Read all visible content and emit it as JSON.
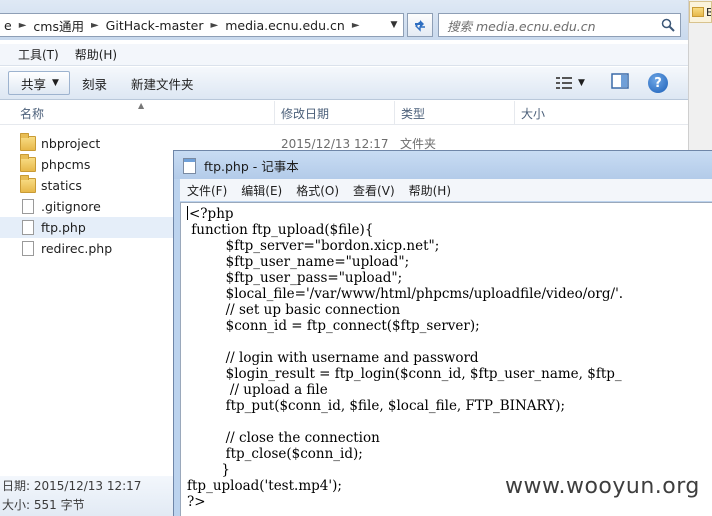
{
  "explorer": {
    "breadcrumbs": [
      "e",
      "cms通用",
      "GitHack-master",
      "media.ecnu.edu.cn"
    ],
    "search_placeholder": "搜索 media.ecnu.edu.cn",
    "menu": [
      "工具(T)",
      "帮助(H)"
    ],
    "toolbar": {
      "share": "共享",
      "burn": "刻录",
      "new_folder": "新建文件夹"
    },
    "columns": {
      "name": "名称",
      "modified": "修改日期",
      "type": "类型",
      "size": "大小"
    },
    "files": [
      {
        "name": "nbproject",
        "kind": "folder"
      },
      {
        "name": "phpcms",
        "kind": "folder"
      },
      {
        "name": "statics",
        "kind": "folder"
      },
      {
        "name": ".gitignore",
        "kind": "file"
      },
      {
        "name": "ftp.php",
        "kind": "file",
        "selected": true
      },
      {
        "name": "redirec.php",
        "kind": "file"
      }
    ],
    "first_row_meta": {
      "modified": "2015/12/13 12:17",
      "type": "文件夹"
    },
    "details": {
      "modified": "日期: 2015/12/13 12:17",
      "size": "大小: 551 字节"
    },
    "side_tab_label": "BT"
  },
  "notepad": {
    "title": "ftp.php - 记事本",
    "menu": [
      "文件(F)",
      "编辑(E)",
      "格式(O)",
      "查看(V)",
      "帮助(H)"
    ],
    "code_lines": [
      "<?php",
      " function ftp_upload($file){",
      "         $ftp_server=\"bordon.xicp.net\";",
      "         $ftp_user_name=\"upload\";",
      "         $ftp_user_pass=\"upload\";",
      "         $local_file='/var/www/html/phpcms/uploadfile/video/org/'.",
      "         // set up basic connection",
      "         $conn_id = ftp_connect($ftp_server);",
      "",
      "         // login with username and password",
      "         $login_result = ftp_login($conn_id, $ftp_user_name, $ftp_",
      "          // upload a file",
      "         ftp_put($conn_id, $file, $local_file, FTP_BINARY);",
      "",
      "         // close the connection",
      "         ftp_close($conn_id);",
      "        }",
      "ftp_upload('test.mp4');",
      "?>"
    ]
  },
  "watermark": "www.wooyun.org"
}
